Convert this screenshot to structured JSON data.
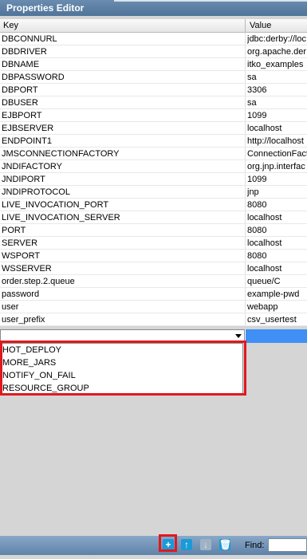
{
  "window": {
    "title": "Properties Editor"
  },
  "table": {
    "columns": [
      "Key",
      "Value"
    ],
    "rows": [
      {
        "key": "DBCONNURL",
        "value": "jdbc:derby://loc"
      },
      {
        "key": "DBDRIVER",
        "value": "org.apache.der"
      },
      {
        "key": "DBNAME",
        "value": "itko_examples"
      },
      {
        "key": "DBPASSWORD",
        "value": "sa"
      },
      {
        "key": "DBPORT",
        "value": "3306"
      },
      {
        "key": "DBUSER",
        "value": "sa"
      },
      {
        "key": "EJBPORT",
        "value": "1099"
      },
      {
        "key": "EJBSERVER",
        "value": "localhost"
      },
      {
        "key": "ENDPOINT1",
        "value": "http://localhost"
      },
      {
        "key": "JMSCONNECTIONFACTORY",
        "value": "ConnectionFact"
      },
      {
        "key": "JNDIFACTORY",
        "value": "org.jnp.interfac"
      },
      {
        "key": "JNDIPORT",
        "value": "1099"
      },
      {
        "key": "JNDIPROTOCOL",
        "value": "jnp"
      },
      {
        "key": "LIVE_INVOCATION_PORT",
        "value": "8080"
      },
      {
        "key": "LIVE_INVOCATION_SERVER",
        "value": "localhost"
      },
      {
        "key": "PORT",
        "value": "8080"
      },
      {
        "key": "SERVER",
        "value": "localhost"
      },
      {
        "key": "WSPORT",
        "value": "8080"
      },
      {
        "key": "WSSERVER",
        "value": "localhost"
      },
      {
        "key": "order.step.2.queue",
        "value": "queue/C"
      },
      {
        "key": "password",
        "value": "example-pwd"
      },
      {
        "key": "user",
        "value": "webapp"
      },
      {
        "key": "user_prefix",
        "value": "csv_usertest"
      }
    ]
  },
  "dropdown": {
    "options": [
      "HOT_DEPLOY",
      "MORE_JARS",
      "NOTIFY_ON_FAIL",
      "RESOURCE_GROUP"
    ]
  },
  "toolbar": {
    "find_label": "Find:",
    "add_icon": "plus-icon",
    "up_icon": "arrow-up-icon",
    "down_icon": "arrow-down-icon",
    "delete_icon": "trash-icon"
  },
  "colors": {
    "highlight": "#e0191e",
    "selection": "#3f8ff5",
    "title_bar": "#4f7399"
  }
}
